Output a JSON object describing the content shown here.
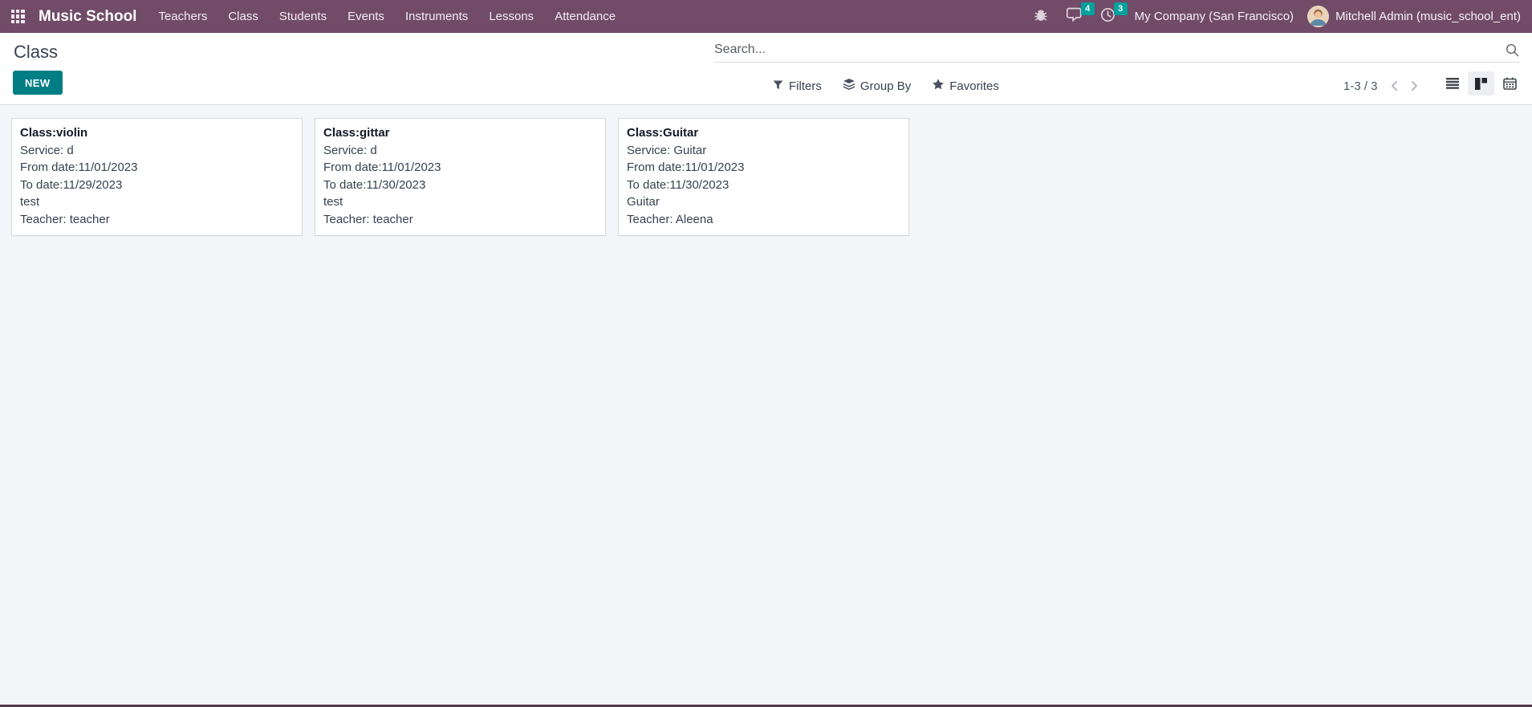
{
  "colors": {
    "navbar_bg": "#714B67",
    "accent_teal": "#017E84",
    "badge_teal": "#00A09D",
    "content_bg": "#F4F5F8",
    "border": "#D8DADD",
    "text_dark": "#374151"
  },
  "navbar": {
    "brand": "Music School",
    "menu_items": [
      "Teachers",
      "Class",
      "Students",
      "Events",
      "Instruments",
      "Lessons",
      "Attendance"
    ],
    "systray": {
      "messages_badge": "4",
      "activities_badge": "3",
      "company": "My Company (San Francisco)",
      "user": "Mitchell Admin (music_school_ent)"
    }
  },
  "control_panel": {
    "title": "Class",
    "new_button_label": "NEW",
    "search_placeholder": "Search...",
    "filters_label": "Filters",
    "group_by_label": "Group By",
    "favorites_label": "Favorites",
    "pager_range": "1-3 / 3"
  },
  "icons": {
    "apps-icon": "3x3-grid",
    "bug-icon": "bug",
    "messages-icon": "chat-bubble",
    "activities-icon": "clock",
    "search-icon": "magnifier",
    "filters-icon": "funnel",
    "group-by-icon": "layers",
    "favorites-icon": "star",
    "previous-icon": "chevron-left",
    "next-icon": "chevron-right",
    "list-view-icon": "list-lines",
    "kanban-view-icon": "kanban-squares",
    "calendar-view-icon": "calendar-grid"
  },
  "cards": [
    {
      "title": "Class:violin",
      "lines": [
        "Service: d",
        "From date:11/01/2023",
        "To date:11/29/2023",
        "test",
        "Teacher: teacher"
      ]
    },
    {
      "title": "Class:gittar",
      "lines": [
        "Service: d",
        "From date:11/01/2023",
        "To date:11/30/2023",
        "test",
        "Teacher: teacher"
      ]
    },
    {
      "title": "Class:Guitar",
      "lines": [
        "Service: Guitar",
        "From date:11/01/2023",
        "To date:11/30/2023",
        "Guitar",
        "Teacher: Aleena"
      ]
    }
  ]
}
